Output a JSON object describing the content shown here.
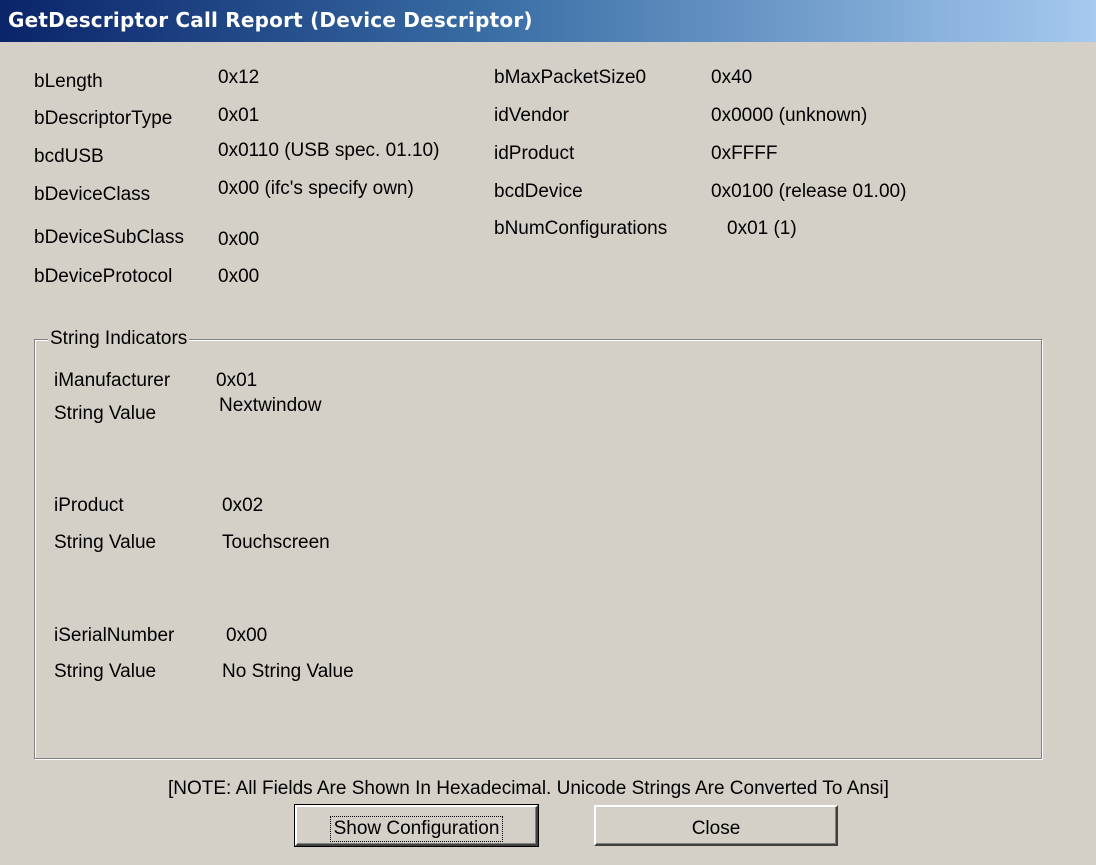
{
  "window": {
    "title": "GetDescriptor Call Report (Device Descriptor)"
  },
  "descriptor_left": [
    {
      "label": "bLength",
      "value": "0x12"
    },
    {
      "label": "bDescriptorType",
      "value": "0x01"
    },
    {
      "label": "bcdUSB",
      "value": "0x0110 (USB spec. 01.10)"
    },
    {
      "label": "bDeviceClass",
      "value": "0x00 (ifc's specify own)"
    },
    {
      "label": "bDeviceSubClass",
      "value": "0x00"
    },
    {
      "label": "bDeviceProtocol",
      "value": "0x00"
    }
  ],
  "descriptor_right": [
    {
      "label": "bMaxPacketSize0",
      "value": "0x40"
    },
    {
      "label": "idVendor",
      "value": "0x0000 (unknown)"
    },
    {
      "label": "idProduct",
      "value": "0xFFFF"
    },
    {
      "label": "bcdDevice",
      "value": "0x0100 (release 01.00)"
    },
    {
      "label": "bNumConfigurations",
      "value": "0x01 (1)"
    }
  ],
  "string_indicators": {
    "legend": "String Indicators",
    "string_value_label": "String Value",
    "items": [
      {
        "label": "iManufacturer",
        "index": "0x01",
        "string_value": "Nextwindow"
      },
      {
        "label": "iProduct",
        "index": "0x02",
        "string_value": "Touchscreen"
      },
      {
        "label": "iSerialNumber",
        "index": "0x00",
        "string_value": "No String Value"
      }
    ]
  },
  "note": "[NOTE: All Fields Are Shown In Hexadecimal.   Unicode Strings Are Converted To Ansi]",
  "buttons": {
    "show_configuration": "Show Configuration",
    "close": "Close"
  }
}
